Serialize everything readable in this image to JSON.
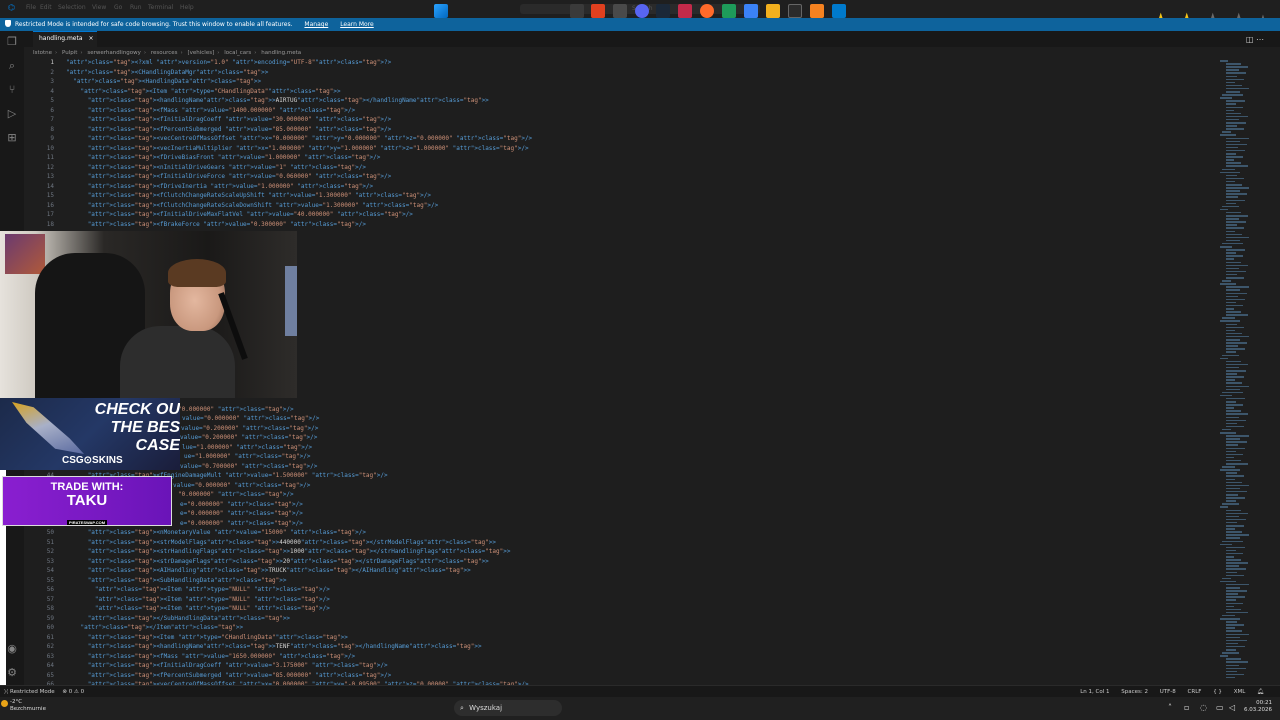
{
  "menu": {
    "items": [
      "File",
      "Edit",
      "Selection",
      "View",
      "Go",
      "Run",
      "Terminal",
      "Help"
    ]
  },
  "search_placeholder": "Search",
  "banner": {
    "text": "Restricted Mode is intended for safe code browsing. Trust this window to enable all features.",
    "manage": "Manage",
    "learn_more": "Learn More"
  },
  "rating": {
    "filled": 2,
    "total": 5
  },
  "tab": {
    "label": "handling.meta",
    "close": "×"
  },
  "breadcrumb": [
    "Istotne",
    "Pulpit",
    "serwerhandlingowy",
    "resources",
    "[vehicles]",
    "local_cars",
    "handling.meta"
  ],
  "editor_lines": [
    {
      "n": "1",
      "code": "<?xml version=\"1.0\" encoding=\"UTF-8\"?>"
    },
    {
      "n": "2",
      "code": "<CHandlingDataMgr>"
    },
    {
      "n": "3",
      "code": "  <HandlingData>"
    },
    {
      "n": "4",
      "code": "    <Item type=\"CHandlingData\">"
    },
    {
      "n": "5",
      "code": "      <handlingName>AIRTUG</handlingName>"
    },
    {
      "n": "6",
      "code": "      <fMass value=\"1400.000000\" />"
    },
    {
      "n": "7",
      "code": "      <fInitialDragCoeff value=\"30.000000\" />"
    },
    {
      "n": "8",
      "code": "      <fPercentSubmerged value=\"85.000000\" />"
    },
    {
      "n": "9",
      "code": "      <vecCentreOfMassOffset x=\"0.000000\" y=\"0.000000\" z=\"0.000000\" />"
    },
    {
      "n": "10",
      "code": "      <vecInertiaMultiplier x=\"1.000000\" y=\"1.000000\" z=\"1.000000\" />"
    },
    {
      "n": "11",
      "code": "      <fDriveBiasFront value=\"1.000000\" />"
    },
    {
      "n": "12",
      "code": "      <nInitialDriveGears value=\"1\" />"
    },
    {
      "n": "13",
      "code": "      <fInitialDriveForce value=\"0.060000\" />"
    },
    {
      "n": "14",
      "code": "      <fDriveInertia value=\"1.000000\" />"
    },
    {
      "n": "15",
      "code": "      <fClutchChangeRateScaleUpShift value=\"1.300000\" />"
    },
    {
      "n": "16",
      "code": "      <fClutchChangeRateScaleDownShift value=\"1.300000\" />"
    },
    {
      "n": "17",
      "code": "      <fInitialDriveMaxFlatVel value=\"40.000000\" />"
    },
    {
      "n": "18",
      "code": "      <fBrakeForce value=\"0.300000\" />"
    }
  ],
  "editor_partial_lines": [
    {
      "code": "\"0.000000\" />"
    },
    {
      "code": "value=\"0.000000\" />"
    },
    {
      "code": "value=\"0.200000\" />"
    },
    {
      "code": "value=\"0.200000\" />"
    },
    {
      "code": "lue=\"1.000000\" />"
    },
    {
      "code": "ue=\"1.000000\" />"
    },
    {
      "code": "value=\"0.700000\" />"
    }
  ],
  "editor_line_44": {
    "n": "44",
    "code": "      <fEngineDamageMult value=\"1.500000\" />"
  },
  "editor_partial_lines2": [
    {
      "code": "value=\"0.000000\" />"
    },
    {
      "code": "\"0.000000\" />"
    },
    {
      "code": "e=\"0.000000\" />"
    },
    {
      "code": "e=\"0.000000\" />"
    },
    {
      "code": "e=\"0.000000\" />"
    }
  ],
  "editor_lines_tail": [
    {
      "n": "50",
      "code": "      <nMonetaryValue value=\"15000\" />"
    },
    {
      "n": "51",
      "code": "      <strModelFlags>440000</strModelFlags>"
    },
    {
      "n": "52",
      "code": "      <strHandlingFlags>1000</strHandlingFlags>"
    },
    {
      "n": "53",
      "code": "      <strDamageFlags>20</strDamageFlags>"
    },
    {
      "n": "54",
      "code": "      <AIHandling>TRUCK</AIHandling>"
    },
    {
      "n": "55",
      "code": "      <SubHandlingData>"
    },
    {
      "n": "56",
      "code": "        <Item type=\"NULL\" />"
    },
    {
      "n": "57",
      "code": "        <Item type=\"NULL\" />"
    },
    {
      "n": "58",
      "code": "        <Item type=\"NULL\" />"
    },
    {
      "n": "59",
      "code": "      </SubHandlingData>"
    },
    {
      "n": "60",
      "code": "    </Item>"
    },
    {
      "n": "61",
      "code": "      <Item type=\"CHandlingData\">"
    },
    {
      "n": "62",
      "code": "      <handlingName>TENF</handlingName>"
    },
    {
      "n": "63",
      "code": "      <fMass value=\"1650.000000\" />"
    },
    {
      "n": "64",
      "code": "      <fInitialDragCoeff value=\"3.175000\" />"
    },
    {
      "n": "65",
      "code": "      <fPercentSubmerged value=\"85.000000\" />"
    },
    {
      "n": "66",
      "code": "      <vecCentreOfMassOffset x=\"0.000000\" y=\"-0.09500\" z=\"0.00000\" />"
    }
  ],
  "ads": {
    "csgo_headline": "CHECK OU\nTHE BES\nCASE",
    "csgo_brand": "CSG⊙SKINS",
    "trade_line1": "TRADE WITH:",
    "trade_line2": "TAKU",
    "trade_line3": "PIRATESWAP.COM"
  },
  "statusbar": {
    "restricted": "Restricted Mode",
    "problems": "⊗ 0 ⚠ 0",
    "position": "Ln 1, Col 1",
    "spaces": "Spaces: 2",
    "encoding": "UTF-8",
    "eol": "CRLF",
    "language": "XML"
  },
  "taskbar": {
    "weather_temp": "-2°C",
    "weather_desc": "Bezchmurnie",
    "search": "Wyszukaj",
    "time": "00:21",
    "date": "6.03.2026"
  },
  "colors": {
    "accent": "#0078d4",
    "banner": "#0e639c",
    "star": "#f5c518"
  }
}
